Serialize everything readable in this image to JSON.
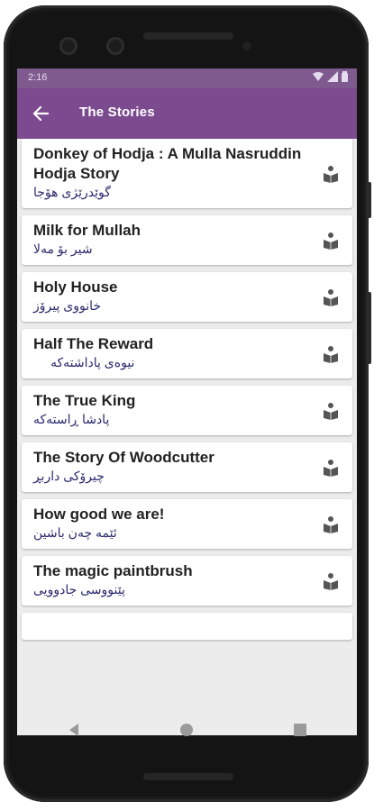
{
  "status_bar": {
    "time": "2:16"
  },
  "app_bar": {
    "title": "The Stories"
  },
  "stories": [
    {
      "title": "Donkey of Hodja : A Mulla Nasruddin Hodja Story",
      "subtitle": "گوێدرێژی هۆجا"
    },
    {
      "title": "Milk for Mullah",
      "subtitle": "شیر بۆ مەلا"
    },
    {
      "title": "Holy House",
      "subtitle": "خانووی پیرۆز"
    },
    {
      "title": "Half The Reward",
      "subtitle": "نیوەی پاداشتەکە"
    },
    {
      "title": "The True King",
      "subtitle": "پادشا ڕاستەکە"
    },
    {
      "title": "The Story Of Woodcutter",
      "subtitle": "چیرۆکی داربڕ"
    },
    {
      "title": "How good we are!",
      "subtitle": "ئێمە چەن باشین"
    },
    {
      "title": "The magic paintbrush",
      "subtitle": "پێنووسی جادوویی"
    }
  ],
  "colors": {
    "app_bar": "#7b4a8f",
    "status_bar": "#7e5a8f",
    "subtitle_text": "#2a2a6e"
  },
  "icons": {
    "back": "arrow-back-icon",
    "story": "book-reader-icon",
    "nav": [
      "back-triangle-icon",
      "home-circle-icon",
      "recents-square-icon"
    ]
  }
}
